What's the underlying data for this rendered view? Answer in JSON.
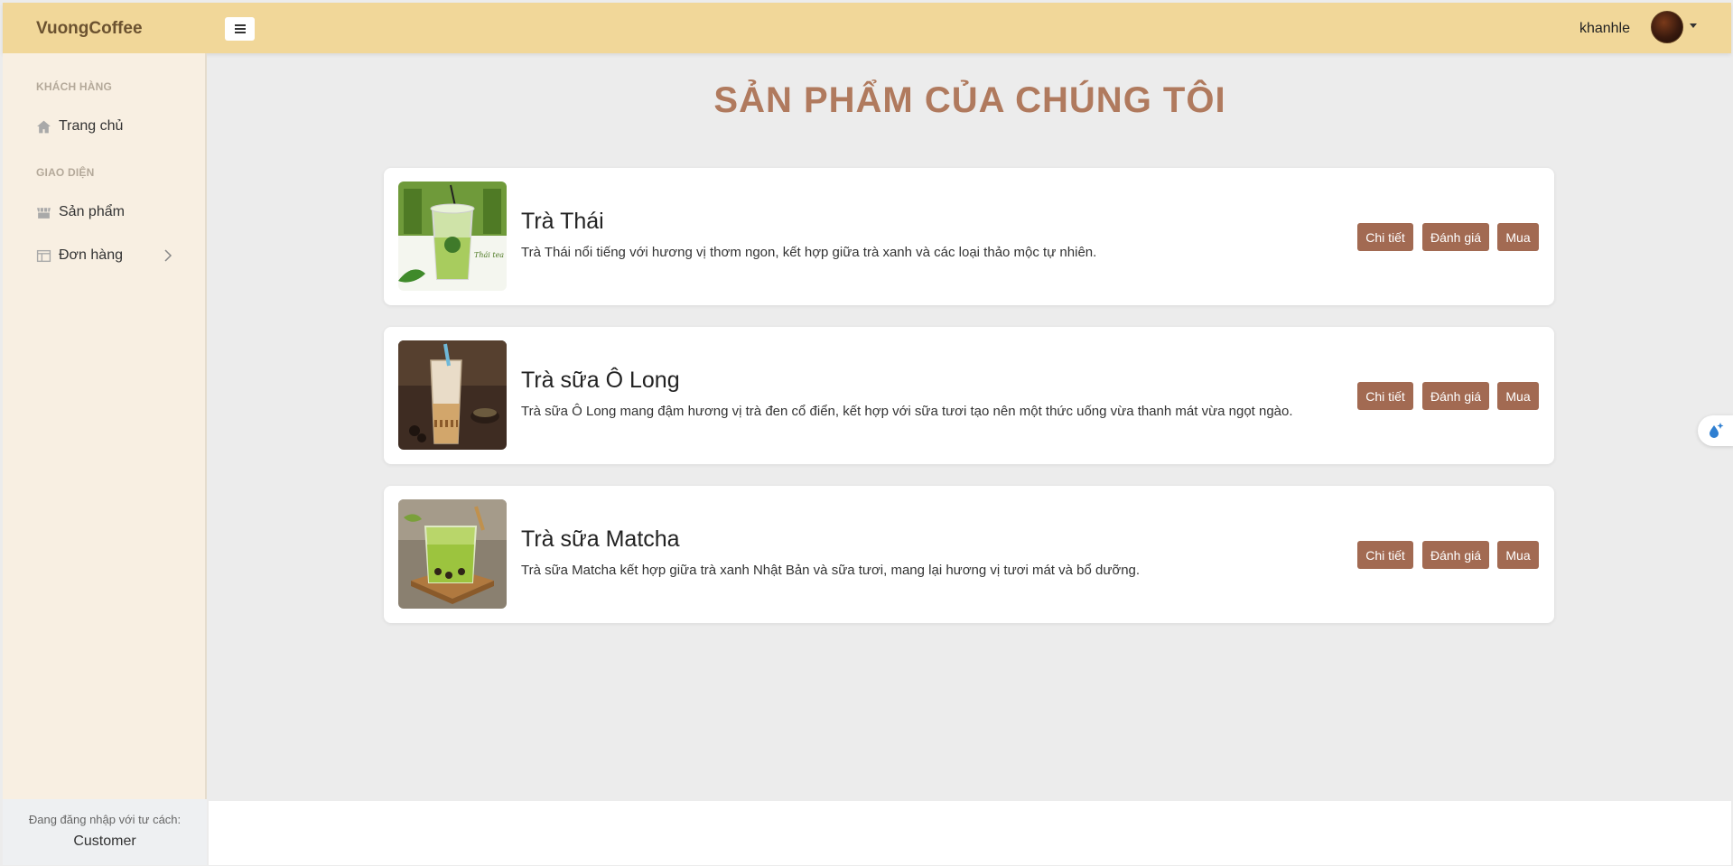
{
  "header": {
    "brand": "VuongCoffee",
    "username": "khanhle"
  },
  "sidebar": {
    "sections": [
      {
        "heading": "KHÁCH HÀNG",
        "items": [
          {
            "label": "Trang chủ",
            "icon": "home-icon"
          }
        ]
      },
      {
        "heading": "GIAO DIỆN",
        "items": [
          {
            "label": "Sản phẩm",
            "icon": "store-icon"
          },
          {
            "label": "Đơn hàng",
            "icon": "layout-icon"
          }
        ]
      }
    ],
    "footer_label": "Đang đăng nhập với tư cách:",
    "footer_role": "Customer"
  },
  "main": {
    "title": "SẢN PHẨM CỦA CHÚNG TÔI",
    "products": [
      {
        "name": "Trà Thái",
        "description": "Trà Thái nổi tiếng với hương vị thơm ngon, kết hợp giữa trà xanh và các loại thảo mộc tự nhiên.",
        "buttons": {
          "detail": "Chi tiết",
          "review": "Đánh giá",
          "buy": "Mua"
        }
      },
      {
        "name": "Trà sữa Ô Long",
        "description": "Trà sữa Ô Long mang đậm hương vị trà đen cổ điển, kết hợp với sữa tươi tạo nên một thức uống vừa thanh mát vừa ngọt ngào.",
        "buttons": {
          "detail": "Chi tiết",
          "review": "Đánh giá",
          "buy": "Mua"
        }
      },
      {
        "name": "Trà sữa Matcha",
        "description": "Trà sữa Matcha kết hợp giữa trà xanh Nhật Bản và sữa tươi, mang lại hương vị tươi mát và bổ dưỡng.",
        "buttons": {
          "detail": "Chi tiết",
          "review": "Đánh giá",
          "buy": "Mua"
        }
      }
    ]
  },
  "colors": {
    "header_bg": "#f1d799",
    "sidebar_bg": "#f8efe2",
    "title": "#b07a5e",
    "button_bg": "#a26a52"
  }
}
